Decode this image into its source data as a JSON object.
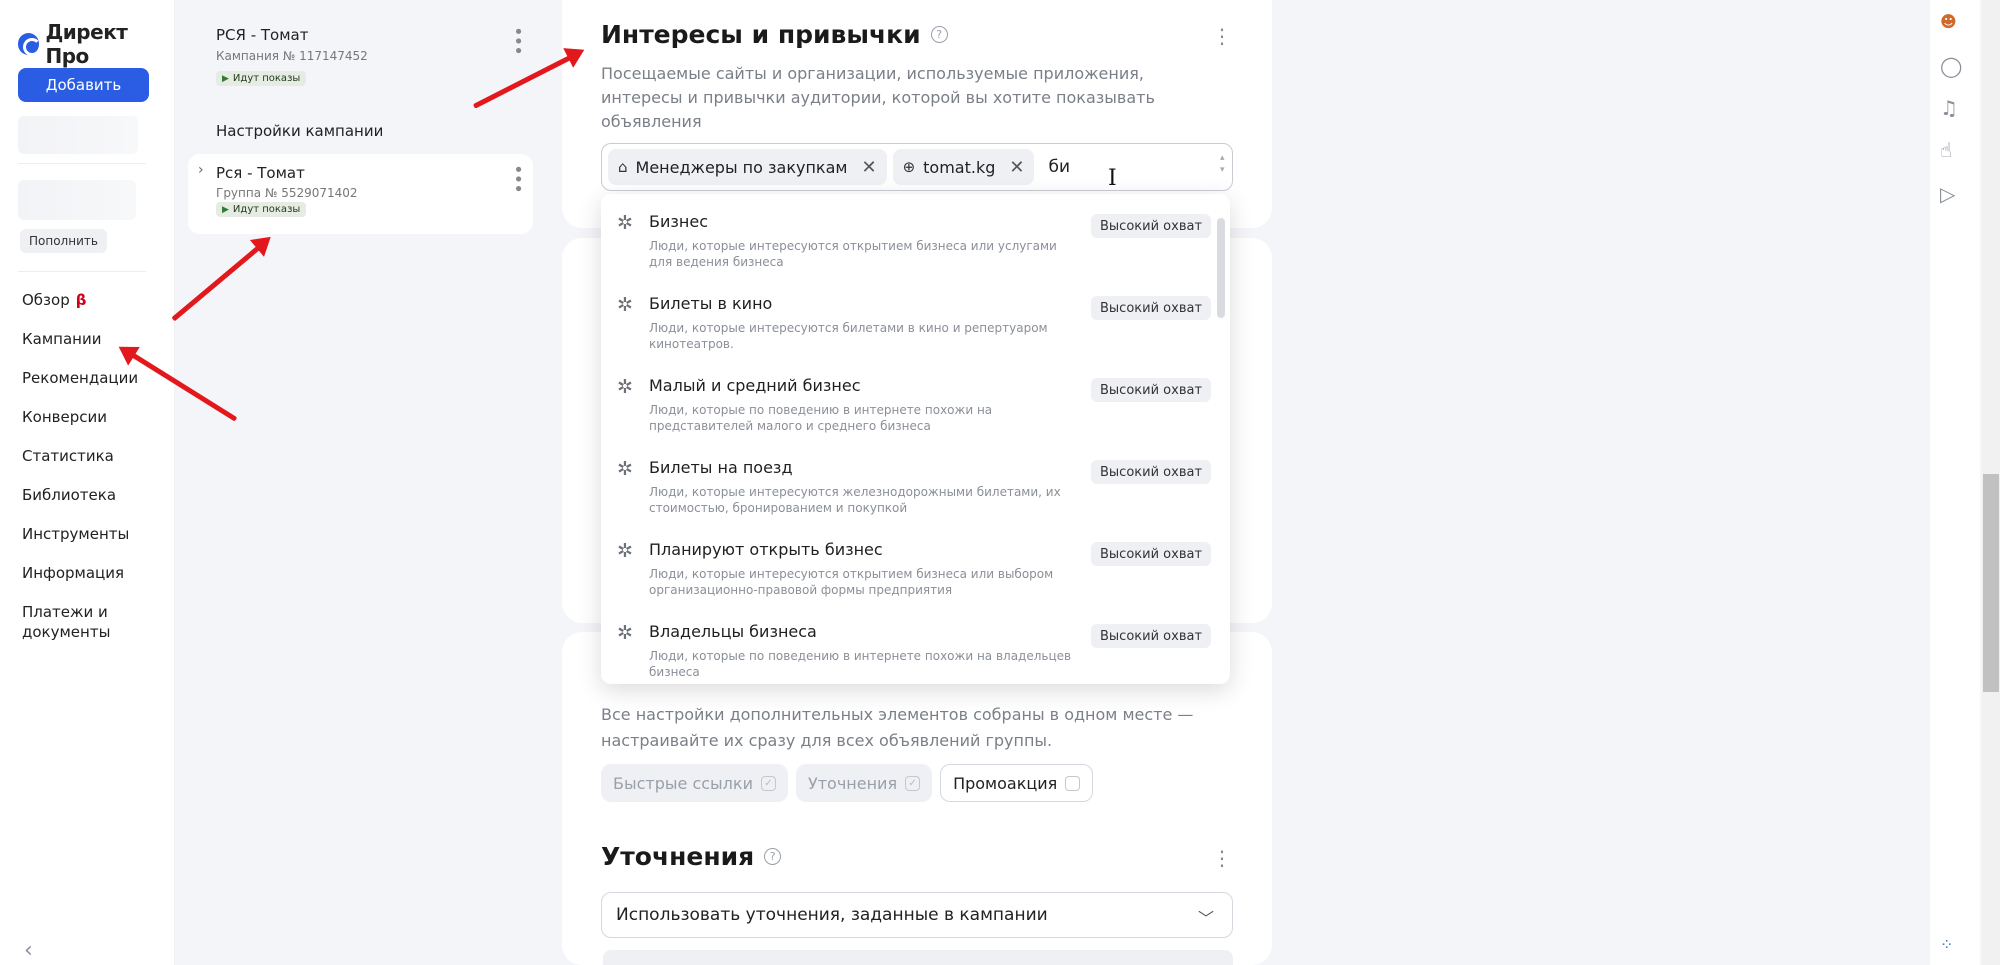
{
  "app": {
    "logo_text": "Директ Про",
    "add_button": "Добавить",
    "topup_button": "Пополнить"
  },
  "nav": {
    "items": [
      {
        "label": "Обзор",
        "beta": "β"
      },
      {
        "label": "Кампании"
      },
      {
        "label": "Рекомендации"
      },
      {
        "label": "Конверсии"
      },
      {
        "label": "Статистика"
      },
      {
        "label": "Библиотека"
      },
      {
        "label": "Инструменты"
      },
      {
        "label": "Информация"
      },
      {
        "label": "Платежи и документы"
      }
    ]
  },
  "campaign": {
    "title": "РСЯ - Томат",
    "subtitle": "Кампания № 117147452",
    "status": "Идут показы",
    "settings_label": "Настройки кампании"
  },
  "group": {
    "title": "Рся - Томат",
    "subtitle": "Группа № 5529071402",
    "status": "Идут показы"
  },
  "interests": {
    "title": "Интересы и привычки",
    "description": "Посещаемые сайты и организации, используемые приложения, интересы и привычки аудитории, которой вы хотите показывать объявления",
    "chips": [
      {
        "label": "Менеджеры по закупкам",
        "icon": "home-puzzle-icon"
      },
      {
        "label": "tomat.kg",
        "icon": "globe-icon"
      }
    ],
    "typed_value": "би",
    "suggestions": [
      {
        "title": "Бизнес",
        "desc": "Люди, которые интересуются открытием бизнеса или услугами для ведения бизнеса",
        "badge": "Высокий охват"
      },
      {
        "title": "Билеты в кино",
        "desc": "Люди, которые интересуются билетами в кино и репертуаром кинотеатров.",
        "badge": "Высокий охват"
      },
      {
        "title": "Малый и средний бизнес",
        "desc": "Люди, которые по поведению в интернете похожи на представителей малого и среднего бизнеса",
        "badge": "Высокий охват"
      },
      {
        "title": "Билеты на поезд",
        "desc": "Люди, которые интересуются железнодорожными билетами, их стоимостью, бронированием и покупкой",
        "badge": "Высокий охват"
      },
      {
        "title": "Планируют открыть бизнес",
        "desc": "Люди, которые интересуются открытием бизнеса или выбором организационно-правовой формы предприятия",
        "badge": "Высокий охват"
      },
      {
        "title": "Владельцы бизнеса",
        "desc": "Люди, которые по поведению в интернете похожи на владельцев бизнеса",
        "badge": "Высокий охват"
      }
    ]
  },
  "extras": {
    "description": "Все настройки дополнительных элементов собраны в одном месте — настраивайте их сразу для всех объявлений группы.",
    "pills": [
      {
        "label": "Быстрые ссылки",
        "checked": true,
        "disabled": true
      },
      {
        "label": "Уточнения",
        "checked": true,
        "disabled": true
      },
      {
        "label": "Промоакция",
        "checked": false,
        "disabled": false
      }
    ]
  },
  "refinements": {
    "title": "Уточнения",
    "select_value": "Использовать уточнения, заданные в кампании"
  },
  "colors": {
    "accent": "#2a5de3",
    "arrow": "#e3181d",
    "beta": "#d0021b"
  }
}
